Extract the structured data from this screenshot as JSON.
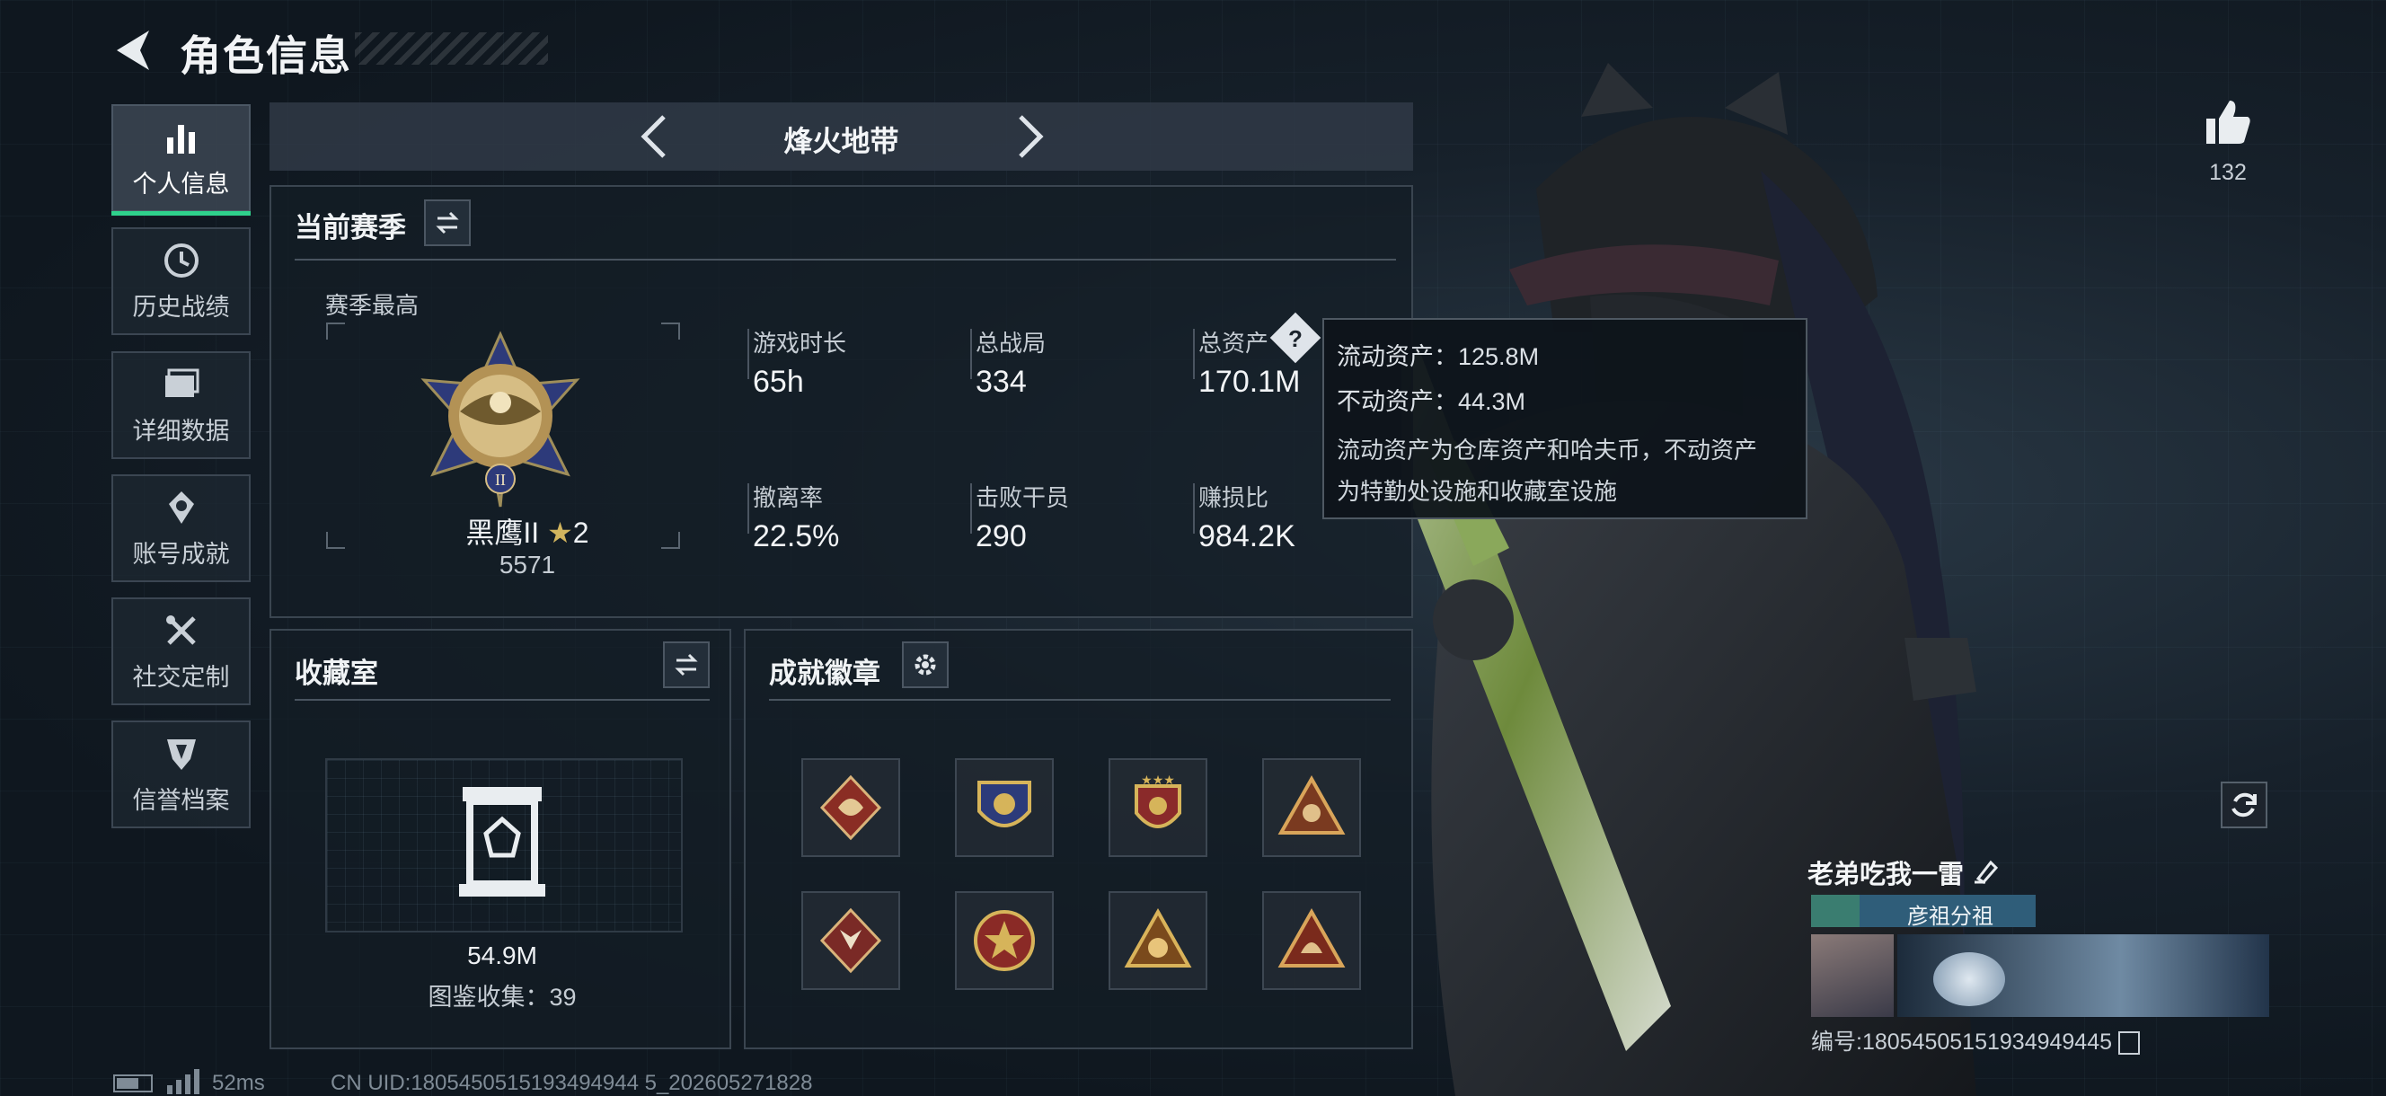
{
  "header": {
    "title": "角色信息"
  },
  "sidebar": {
    "items": [
      {
        "label": "个人信息",
        "icon": "bar-chart-icon",
        "active": true
      },
      {
        "label": "历史战绩",
        "icon": "history-clock-icon"
      },
      {
        "label": "详细数据",
        "icon": "folder-icon"
      },
      {
        "label": "账号成就",
        "icon": "medal-icon"
      },
      {
        "label": "社交定制",
        "icon": "tools-icon"
      },
      {
        "label": "信誉档案",
        "icon": "shield-icon"
      }
    ]
  },
  "mode": {
    "name": "烽火地带"
  },
  "season": {
    "title": "当前赛季",
    "best_label": "赛季最高",
    "rank_name": "黑鹰II",
    "rank_stars": "2",
    "rank_score": "5571",
    "rank_numeral": "II",
    "stats": [
      {
        "label": "游戏时长",
        "value": "65h"
      },
      {
        "label": "总战局",
        "value": "334"
      },
      {
        "label": "总资产",
        "value": "170.1M"
      },
      {
        "label": "撤离率",
        "value": "22.5%"
      },
      {
        "label": "击败干员",
        "value": "290"
      },
      {
        "label": "赚损比",
        "value": "984.2K"
      }
    ],
    "help_icon": "?"
  },
  "tooltip": {
    "liquid": "流动资产：125.8M",
    "fixed": "不动资产：44.3M",
    "desc_line1": "流动资产为仓库资产和哈夫币，不动资产",
    "desc_line2": "为特勤处设施和收藏室设施"
  },
  "collection": {
    "title": "收藏室",
    "value": "54.9M",
    "catalog": "图鉴收集：39"
  },
  "badges": {
    "title": "成就徽章",
    "items": [
      "dragon-badge-icon",
      "shield-emblem-badge-icon",
      "star-crest-badge-icon",
      "squad-triangle-badge-icon",
      "wolf-badge-icon",
      "star-wreath-badge-icon",
      "skull-triangle-badge-icon",
      "helmet-triangle-badge-icon"
    ]
  },
  "like": {
    "count": "132"
  },
  "player": {
    "name": "老弟吃我一雷",
    "tag": "彦祖分祖",
    "uid_line": "编号:1805450515193494944​5"
  },
  "footer": {
    "ping": "52ms",
    "uid": "CN UID:1805450515193494944 5_202605271828"
  },
  "colors": {
    "accent": "#2fd18c",
    "panel": "#141d26",
    "tag_bg": "#2f5d79"
  }
}
